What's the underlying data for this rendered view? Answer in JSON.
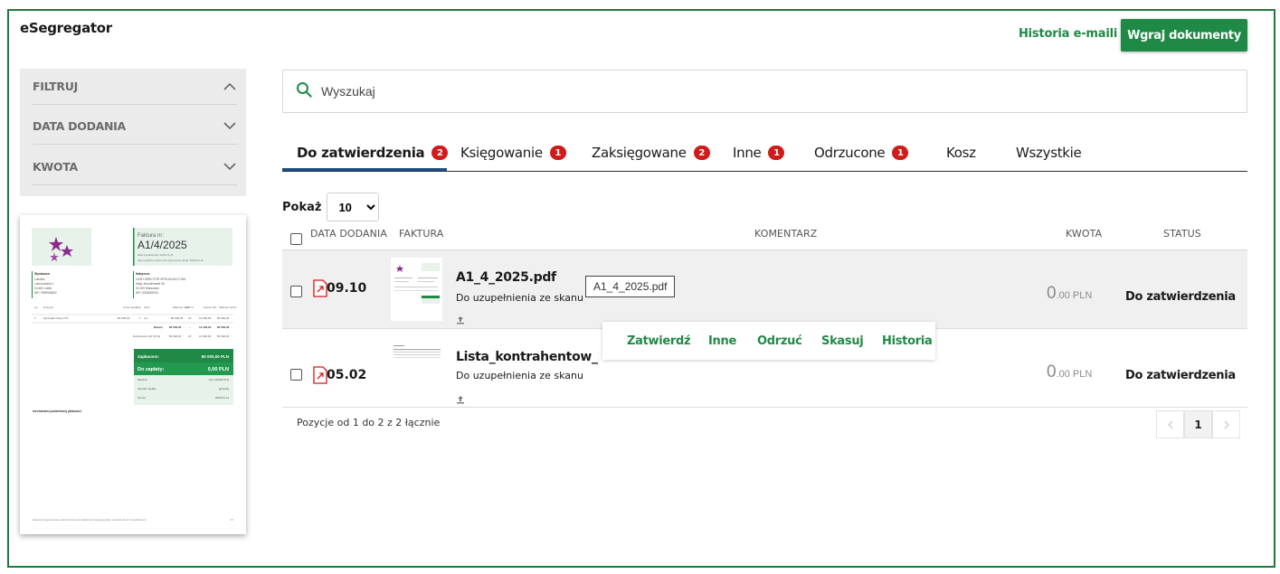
{
  "app": {
    "title": "eSegregator"
  },
  "header": {
    "history_link": "Historia e-maili",
    "upload_button": "Wgraj dokumenty"
  },
  "filters": {
    "title": "FILTRUJ",
    "items": [
      "DATA DODANIA",
      "KWOTA"
    ]
  },
  "preview": {
    "invoice_label": "Faktura nr:",
    "invoice_number": "A1/4/2025",
    "date_line1": "data wystawienia: 2025-01-11",
    "date_line2": "data wydania towaru lub wykonania usługi: 2025-04-11",
    "seller_label": "Wystawca:",
    "seller_lines": [
      "Lokoliko",
      "Lotosnowska 1",
      "20-600 Lublin",
      "NIP: 9999948292"
    ],
    "buyer_label": "Nabywca:",
    "buyer_lines": [
      "CASH DIRECTOR SPÓŁKA AKCYJNA",
      "Aleja Jerozolimskie 56",
      "00-000 Warszawa",
      "NIP: 5252889734"
    ],
    "table_headers": [
      "Lp.",
      "Pozycja",
      "Cena netto",
      "Ilość",
      "Jedn.",
      "Wartość netto",
      "VAT %",
      "Kwota VAT",
      "Wartość brutto"
    ],
    "table_row": [
      "1",
      "Sprzedaż usług 17%",
      "80 000,00",
      "1",
      "szt.",
      "80 000,00",
      "23",
      "14 000,00",
      "80 000,00"
    ],
    "sum_row": [
      "Razem",
      "80 000,00",
      "--",
      "14 000,00",
      "80 000,00"
    ],
    "w_tym_row": [
      "Rozliczenie VAT (PLN)",
      "80 000,00",
      "23",
      "14 000,00",
      "80 000,00"
    ],
    "paid_label": "Zapłacono:",
    "paid_value": "80 000,00 PLN",
    "due_label": "Do zapłaty:",
    "due_value": "0,00 PLN",
    "words_label": "Słownie:",
    "words_value": "zero 00/100 PLN",
    "method_label": "Sposób zapłaty:",
    "method_value": "gotówka",
    "term_label": "Termin:",
    "term_value": "2025-01-11",
    "signature_note": "mechanizm podzielonej płatności",
    "footer": "Dokument wygenerowany elektronicznie przez platformę integrującą usługi i narzędzia dla firm (Cashdirector)",
    "page": "1/1"
  },
  "search": {
    "placeholder": "Wyszukaj"
  },
  "tabs": [
    {
      "label": "Do zatwierdzenia",
      "badge": "2"
    },
    {
      "label": "Księgowanie",
      "badge": "1"
    },
    {
      "label": "Zaksięgowane",
      "badge": "2"
    },
    {
      "label": "Inne",
      "badge": "1"
    },
    {
      "label": "Odrzucone",
      "badge": "1"
    },
    {
      "label": "Kosz",
      "badge": ""
    },
    {
      "label": "Wszystkie",
      "badge": ""
    }
  ],
  "show": {
    "label": "Pokaż",
    "selected": "10",
    "options": [
      "10"
    ]
  },
  "table": {
    "headers": {
      "date": "DATA DODANIA",
      "invoice": "FAKTURA",
      "comment": "KOMENTARZ",
      "amount": "KWOTA",
      "status": "STATUS"
    },
    "rows": [
      {
        "date": "09.10",
        "file": "A1_4_2025.pdf",
        "note": "Do uzupełnienia ze skanu",
        "tooltip": "A1_4_2025.pdf",
        "amount_int": "0",
        "amount_dec": ".00 PLN",
        "status": "Do zatwierdzenia"
      },
      {
        "date": "05.02",
        "file": "Lista_kontrahentow_2025",
        "note": "Do uzupełnienia ze skanu",
        "amount_int": "0",
        "amount_dec": ".00 PLN",
        "status": "Do zatwierdzenia"
      }
    ]
  },
  "row_actions": [
    "Zatwierdź",
    "Inne",
    "Odrzuć",
    "Skasuj",
    "Historia"
  ],
  "pagination": {
    "info": "Pozycje od 1 do 2 z 2 łącznie",
    "current": "1"
  },
  "colors": {
    "brand_green": "#1e8a46",
    "badge_red": "#d11a1a",
    "active_tab_underline": "#1f4f8a"
  }
}
